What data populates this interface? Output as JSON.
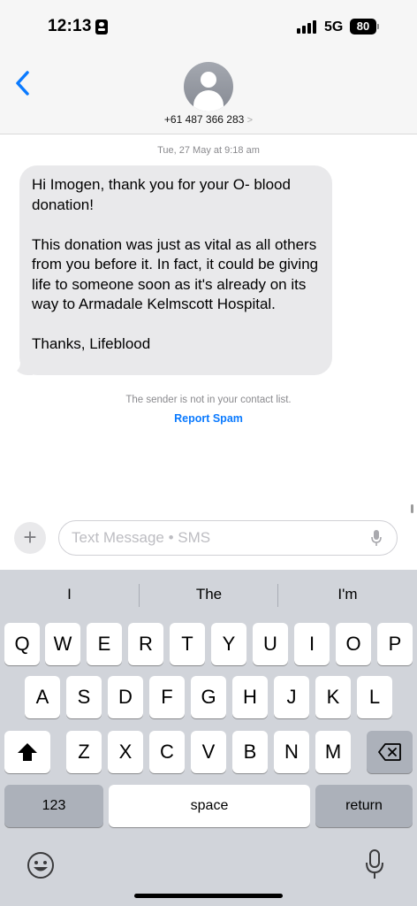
{
  "status_bar": {
    "time": "12:13",
    "network": "5G",
    "battery": "80"
  },
  "header": {
    "back_icon": "chevron-left-icon",
    "avatar_icon": "person-icon",
    "contact": "+61 487 366 283",
    "contact_chevron": ">"
  },
  "conversation": {
    "timestamp": "Tue, 27 May at 9:18 am",
    "message": {
      "line1": "Hi Imogen, thank you for your O- blood donation!",
      "line2": "This donation was just as vital as all others from you before it. In fact, it could be giving life to someone soon as it's already on its way to  Armadale Kelmscott Hospital.",
      "line3": "Thanks, Lifeblood"
    },
    "notice": "The sender is not in your contact list.",
    "report_spam": "Report Spam"
  },
  "composer": {
    "plus": "+",
    "placeholder": "Text Message • SMS"
  },
  "keyboard": {
    "suggestions": [
      "I",
      "The",
      "I'm"
    ],
    "row1": [
      "Q",
      "W",
      "E",
      "R",
      "T",
      "Y",
      "U",
      "I",
      "O",
      "P"
    ],
    "row2": [
      "A",
      "S",
      "D",
      "F",
      "G",
      "H",
      "J",
      "K",
      "L"
    ],
    "row3": [
      "Z",
      "X",
      "C",
      "V",
      "B",
      "N",
      "M"
    ],
    "numbers": "123",
    "space": "space",
    "return": "return",
    "shift_icon": "shift-icon",
    "delete_icon": "backspace-icon",
    "emoji_icon": "emoji-icon",
    "dictation_icon": "microphone-icon"
  },
  "colors": {
    "accent": "#0a7aff",
    "bubble": "#e9e9eb",
    "keyboard": "#d1d4da"
  }
}
